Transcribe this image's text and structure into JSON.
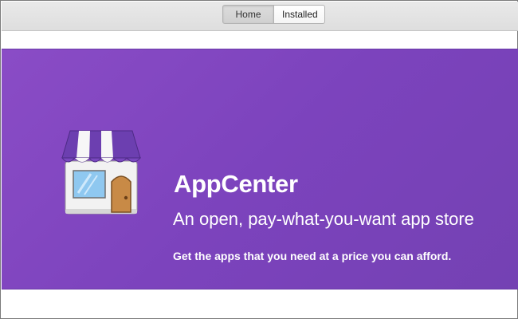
{
  "header": {
    "view_switcher": {
      "home_label": "Home",
      "installed_label": "Installed",
      "selected": "Home"
    }
  },
  "banner": {
    "title": "AppCenter",
    "subtitle": "An open, pay-what-you-want app store",
    "description": "Get the apps that you need at a price you can afford.",
    "icon": "appcenter-storefront-icon",
    "background_color": "#7f45bd"
  }
}
